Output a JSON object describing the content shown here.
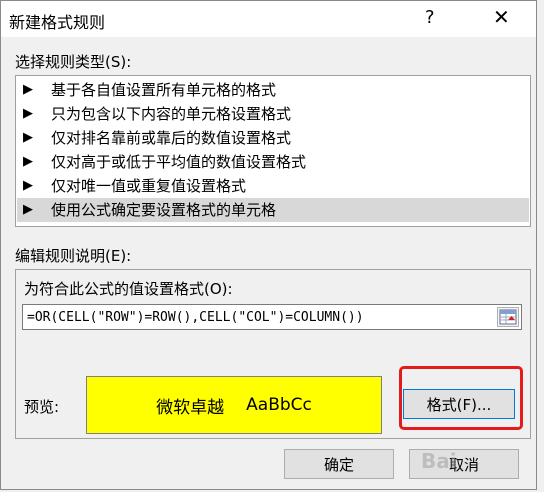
{
  "window": {
    "title": "新建格式规则",
    "help_label": "?",
    "close_label": "✕"
  },
  "rule_type": {
    "label": "选择规则类型(S):",
    "items": [
      {
        "label": "基于各自值设置所有单元格的格式",
        "selected": false
      },
      {
        "label": "只为包含以下内容的单元格设置格式",
        "selected": false
      },
      {
        "label": "仅对排名靠前或靠后的数值设置格式",
        "selected": false
      },
      {
        "label": "仅对高于或低于平均值的数值设置格式",
        "selected": false
      },
      {
        "label": "仅对唯一值或重复值设置格式",
        "selected": false
      },
      {
        "label": "使用公式确定要设置格式的单元格",
        "selected": true
      }
    ],
    "arrow": "▶"
  },
  "description": {
    "label": "编辑规则说明(E):",
    "formula_label": "为符合此公式的值设置格式(O):",
    "formula_value": "=OR(CELL(\"ROW\")=ROW(),CELL(\"COL\")=COLUMN())",
    "preview_label": "预览:",
    "preview_text_cn": "微软卓越",
    "preview_text_en": "AaBbCc",
    "preview_color": "#ffff00",
    "format_button": "格式(F)..."
  },
  "footer": {
    "ok_label": "确定",
    "cancel_label": "取消"
  },
  "highlight_color": "#e41b1b",
  "watermark": "Bai"
}
